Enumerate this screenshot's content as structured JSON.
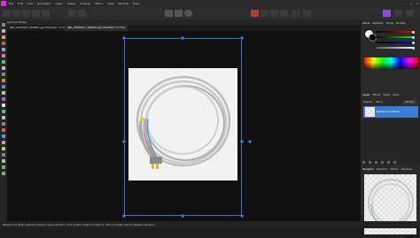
{
  "menu": {
    "items": [
      "File",
      "Edit",
      "Text",
      "Document",
      "Layer",
      "Select",
      "Arrange",
      "Filters",
      "View",
      "Window",
      "Help"
    ]
  },
  "context": {
    "label": "Background (Pixel)"
  },
  "tabs": [
    {
      "label": "IMG_20200227_000652.jpg (Modified) (77.4%)",
      "active": false
    },
    {
      "label": "IMG_20200227_000202.jpg (Modified) (77.3%)",
      "active": true
    }
  ],
  "status": {
    "text": "Background (Pixel) selected. Drag to move selection. Click another object to select it. Click on empty area to deselect selection."
  },
  "panel": {
    "top_tabs": [
      "Colour",
      "Swatches",
      "Stroke",
      "Brushes"
    ],
    "layers_tabs": [
      "Layers",
      "Effects",
      "Styles",
      "Stock"
    ],
    "opacity_label": "Opacity:",
    "opacity_value": "100 %",
    "blend_mode": "Normal",
    "layer_name": "Background (Pixel)",
    "nav_tabs": [
      "Navigator",
      "Transform",
      "History",
      "Channels"
    ]
  },
  "colors": {
    "accent": "#8a4fd0",
    "selection": "#3f6fd0",
    "layer_highlight": "#3c7bd2"
  }
}
